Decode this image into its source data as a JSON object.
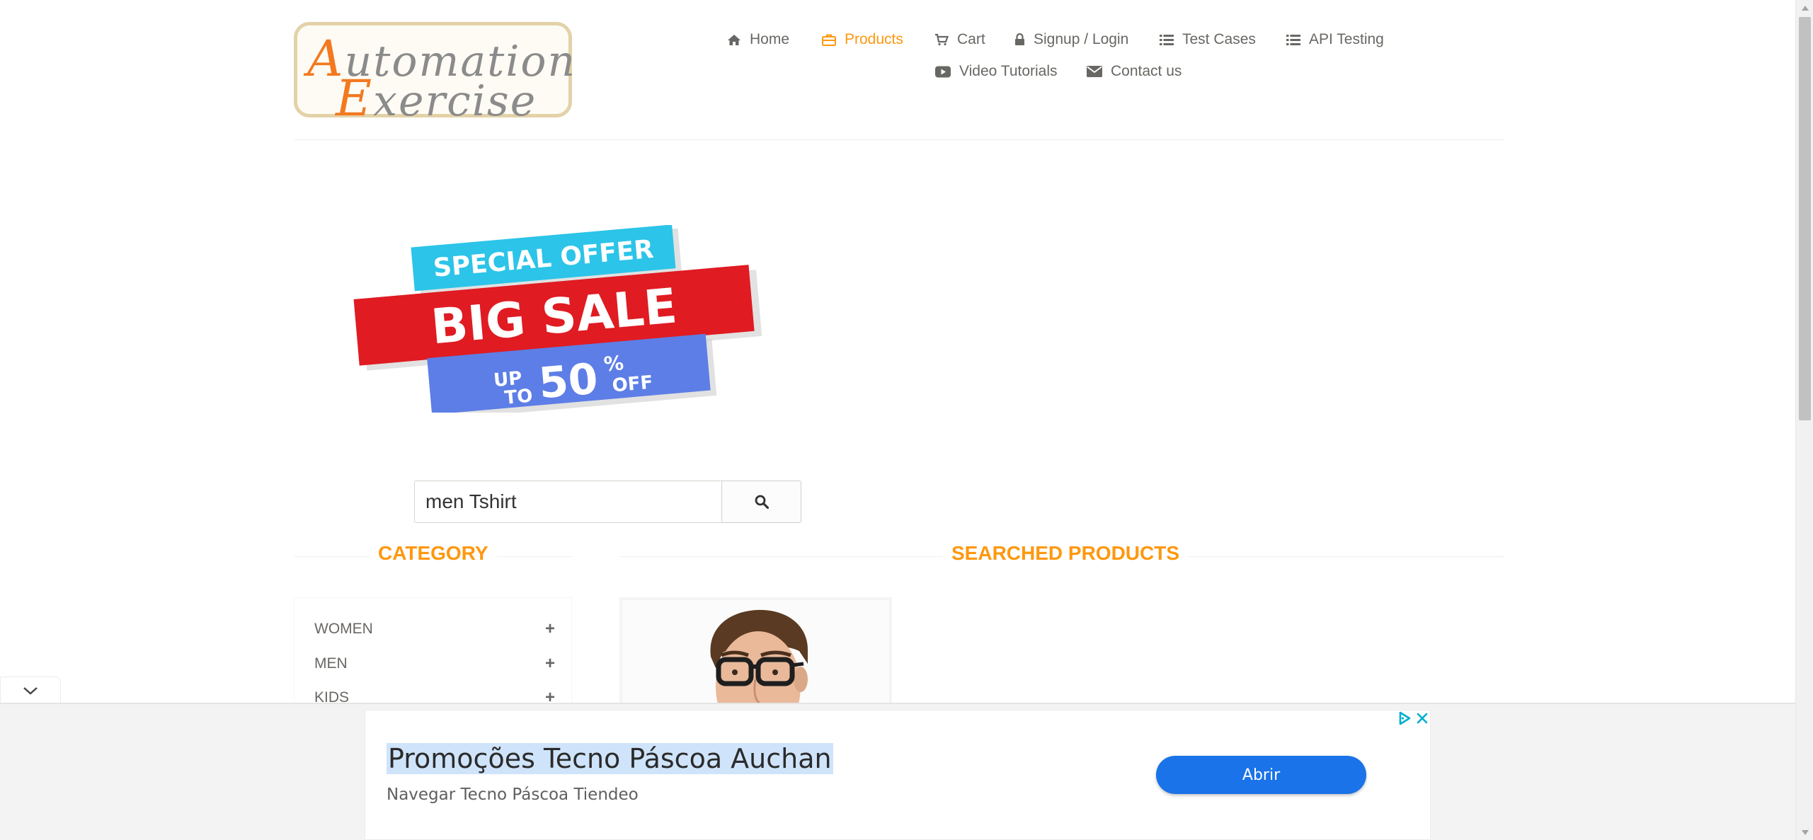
{
  "logo": {
    "line1_cap": "A",
    "line1_rest": "utomation",
    "line2_cap": "E",
    "line2_rest": "xercise",
    "accent_color": "#f37920"
  },
  "nav": {
    "items": [
      {
        "label": "Home",
        "icon": "home-icon"
      },
      {
        "label": "Products",
        "icon": "briefcase-icon",
        "active": true
      },
      {
        "label": "Cart",
        "icon": "cart-icon"
      },
      {
        "label": "Signup / Login",
        "icon": "lock-icon"
      },
      {
        "label": "Test Cases",
        "icon": "list-icon"
      },
      {
        "label": "API Testing",
        "icon": "list-icon"
      },
      {
        "label": "Video Tutorials",
        "icon": "youtube-icon"
      },
      {
        "label": "Contact us",
        "icon": "envelope-icon"
      }
    ],
    "active_color": "#fe980f"
  },
  "banner": {
    "line1": "SPECIAL OFFER",
    "line2": "BIG SALE",
    "up": "UP",
    "to": "TO",
    "percent": "50",
    "percent_sign": "%",
    "off": "OFF"
  },
  "search": {
    "value": "men Tshirt",
    "icon": "search-icon"
  },
  "sections": {
    "category_title": "CATEGORY",
    "products_title": "SEARCHED PRODUCTS"
  },
  "categories": [
    {
      "label": "WOMEN",
      "icon": "plus-icon"
    },
    {
      "label": "MEN",
      "icon": "plus-icon"
    },
    {
      "label": "KIDS",
      "icon": "plus-icon"
    }
  ],
  "ad": {
    "title": "Promoções Tecno Páscoa Auchan",
    "subtitle": "Navegar Tecno Páscoa Tiendeo",
    "button_label": "Abrir",
    "button_color": "#1a73e8"
  }
}
